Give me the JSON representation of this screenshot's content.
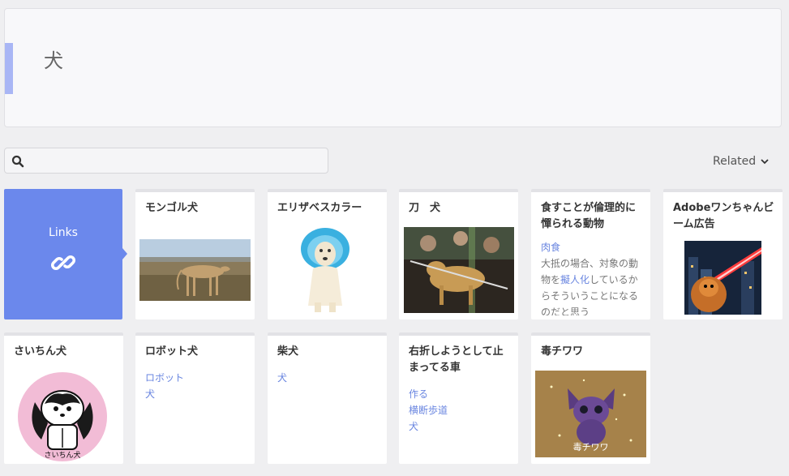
{
  "header": {
    "title": "犬"
  },
  "search": {
    "placeholder": ""
  },
  "related": {
    "label": "Related"
  },
  "links_card": {
    "label": "Links"
  },
  "cards": [
    {
      "title": "モンゴル犬"
    },
    {
      "title": "エリザベスカラー"
    },
    {
      "title": "刀　犬"
    },
    {
      "title": "食すことが倫理的に憚られる動物",
      "link": "肉食",
      "text_1": "大抵の場合、対象の動物を",
      "link_2": "擬人化",
      "text_2": "しているからそういうことになるのだと思う"
    },
    {
      "title": "Adobeワンちゃんビーム広告"
    },
    {
      "title": "さいちん犬",
      "image_caption": "さいちん犬"
    },
    {
      "title": "ロボット犬",
      "links": [
        "ロボット",
        "犬"
      ]
    },
    {
      "title": "柴犬",
      "links": [
        "犬"
      ]
    },
    {
      "title": "右折しようとして止まってる車",
      "links": [
        "作る",
        "横断歩道",
        "犬"
      ]
    },
    {
      "title": "毒チワワ",
      "image_caption": "毒チワワ"
    }
  ],
  "colors": {
    "accent": "#6b88ec",
    "link": "#6a86e0",
    "header_bar": "#a9b6f5"
  }
}
